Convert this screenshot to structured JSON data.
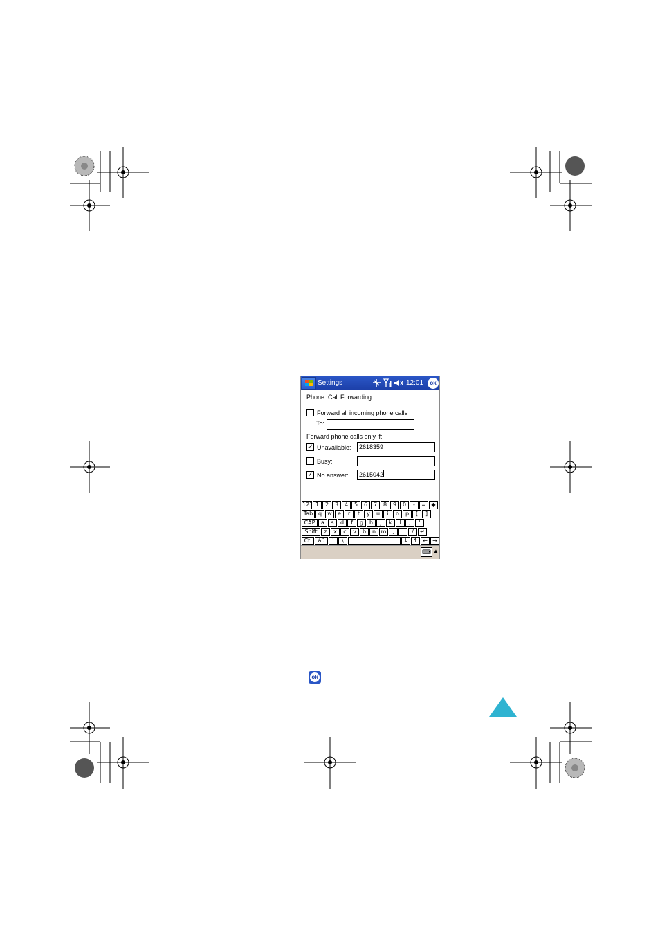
{
  "titlebar": {
    "title": "Settings",
    "clock": "12:01",
    "ok_label": "ok",
    "icons": [
      "windows-flag-icon",
      "connectivity-icon",
      "signal-icon",
      "speaker-icon"
    ]
  },
  "page": {
    "heading": "Phone: Call Forwarding"
  },
  "forward_all": {
    "label": "Forward all incoming phone calls",
    "checked": false,
    "to_label": "To:",
    "to_value": ""
  },
  "conditional": {
    "label": "Forward phone calls only if:",
    "unavailable": {
      "label": "Unavailable:",
      "checked": true,
      "value": "2618359"
    },
    "busy": {
      "label": "Busy:",
      "checked": false,
      "value": ""
    },
    "no_answer": {
      "label": "No answer:",
      "checked": true,
      "value": "2615042"
    }
  },
  "keyboard": {
    "rows": [
      [
        "123",
        "1",
        "2",
        "3",
        "4",
        "5",
        "6",
        "7",
        "8",
        "9",
        "0",
        "-",
        "=",
        "◆"
      ],
      [
        "Tab",
        "q",
        "w",
        "e",
        "r",
        "t",
        "y",
        "u",
        "i",
        "o",
        "p",
        "[",
        "]"
      ],
      [
        "CAP",
        "a",
        "s",
        "d",
        "f",
        "g",
        "h",
        "j",
        "k",
        "l",
        ";",
        "'"
      ],
      [
        "Shift",
        "z",
        "x",
        "c",
        "v",
        "b",
        "n",
        "m",
        ",",
        ".",
        "/",
        "↵"
      ],
      [
        "Ctl",
        "áü",
        "`",
        "\\",
        "",
        "↓",
        "↑",
        "←",
        "→"
      ]
    ]
  },
  "menubar": {
    "sip_icon": "keyboard-icon",
    "arrow": "▲"
  },
  "inline_ok": "ok",
  "colors": {
    "titlebar": "#1c3fa8",
    "menubar": "#dad0c4",
    "triangle": "#2fb3d1"
  }
}
